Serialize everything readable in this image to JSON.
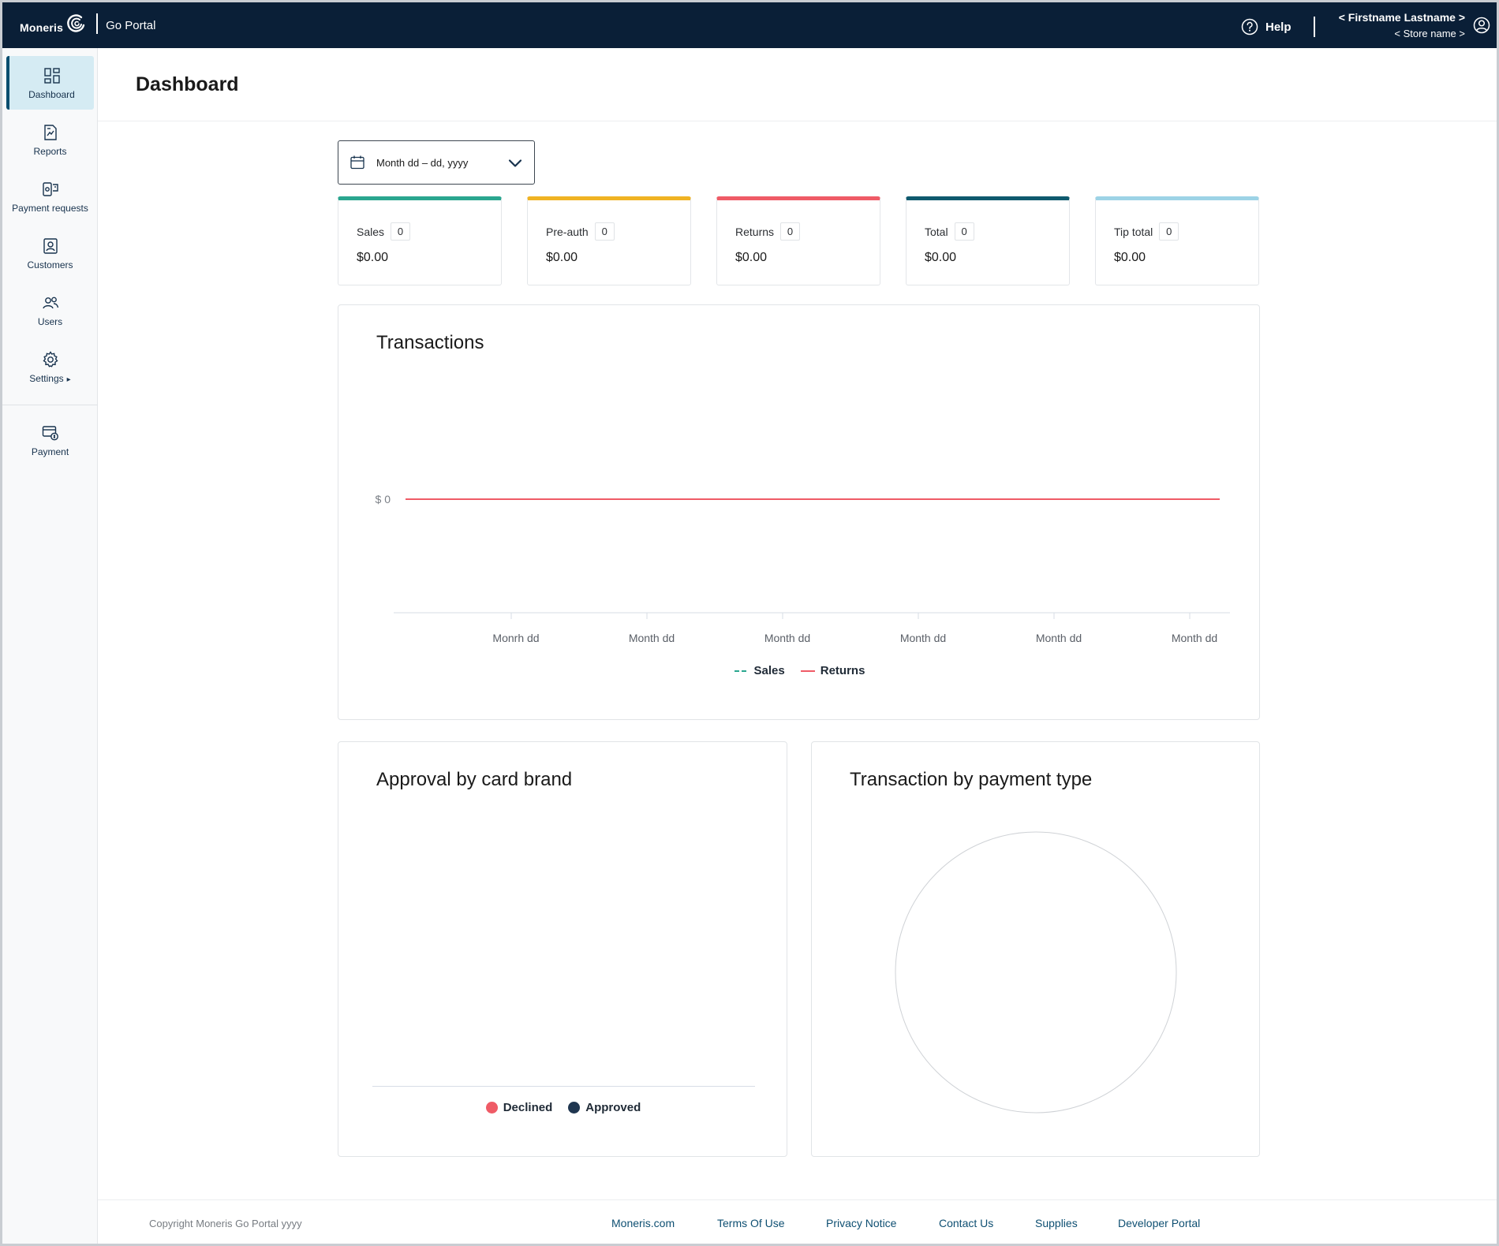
{
  "header": {
    "brand": "Moneris",
    "product": "Go Portal",
    "help_label": "Help",
    "user_name": "< Firstname Lastname >",
    "store_name": "< Store name >"
  },
  "sidebar": {
    "items": [
      {
        "label": "Dashboard",
        "icon": "dashboard-icon"
      },
      {
        "label": "Reports",
        "icon": "reports-icon"
      },
      {
        "label": "Payment requests",
        "icon": "payment-requests-icon"
      },
      {
        "label": "Customers",
        "icon": "customers-icon"
      },
      {
        "label": "Users",
        "icon": "users-icon"
      },
      {
        "label": "Settings",
        "icon": "settings-icon"
      },
      {
        "label": "Payment",
        "icon": "payment-icon"
      }
    ],
    "active": "Dashboard"
  },
  "page": {
    "title": "Dashboard",
    "date_range": "Month dd – dd, yyyy"
  },
  "stats": [
    {
      "label": "Sales",
      "count": "0",
      "amount": "$0.00",
      "color": "#2aa68f"
    },
    {
      "label": "Pre-auth",
      "count": "0",
      "amount": "$0.00",
      "color": "#f0b323"
    },
    {
      "label": "Returns",
      "count": "0",
      "amount": "$0.00",
      "color": "#ef5b66"
    },
    {
      "label": "Total",
      "count": "0",
      "amount": "$0.00",
      "color": "#0f5a6e"
    },
    {
      "label": "Tip total",
      "count": "0",
      "amount": "$0.00",
      "color": "#9dd3e6"
    }
  ],
  "transactions": {
    "title": "Transactions",
    "chart_data": {
      "type": "line",
      "categories": [
        "Monrh dd",
        "Month dd",
        "Month dd",
        "Month dd",
        "Month dd",
        "Month dd"
      ],
      "series": [
        {
          "name": "Sales",
          "values": [
            0,
            0,
            0,
            0,
            0,
            0
          ],
          "color": "#2aa68f",
          "style": "dashed"
        },
        {
          "name": "Returns",
          "values": [
            0,
            0,
            0,
            0,
            0,
            0
          ],
          "color": "#ef5b66",
          "style": "solid"
        }
      ],
      "y_tick_label": "$ 0",
      "legend_position": "bottom"
    }
  },
  "approval": {
    "title": "Approval by card brand",
    "chart_data": {
      "type": "bar",
      "categories": [],
      "series": [
        {
          "name": "Declined",
          "values": [],
          "color": "#ef5b66"
        },
        {
          "name": "Approved",
          "values": [],
          "color": "#1f3650"
        }
      ],
      "legend_position": "bottom"
    }
  },
  "payment_type": {
    "title": "Transaction by payment type",
    "chart_data": {
      "type": "pie",
      "slices": []
    }
  },
  "footer": {
    "copyright": "Copyright Moneris Go Portal  yyyy",
    "links": [
      "Moneris.com",
      "Terms Of Use",
      "Privacy Notice",
      "Contact Us",
      "Supplies",
      "Developer Portal"
    ]
  }
}
